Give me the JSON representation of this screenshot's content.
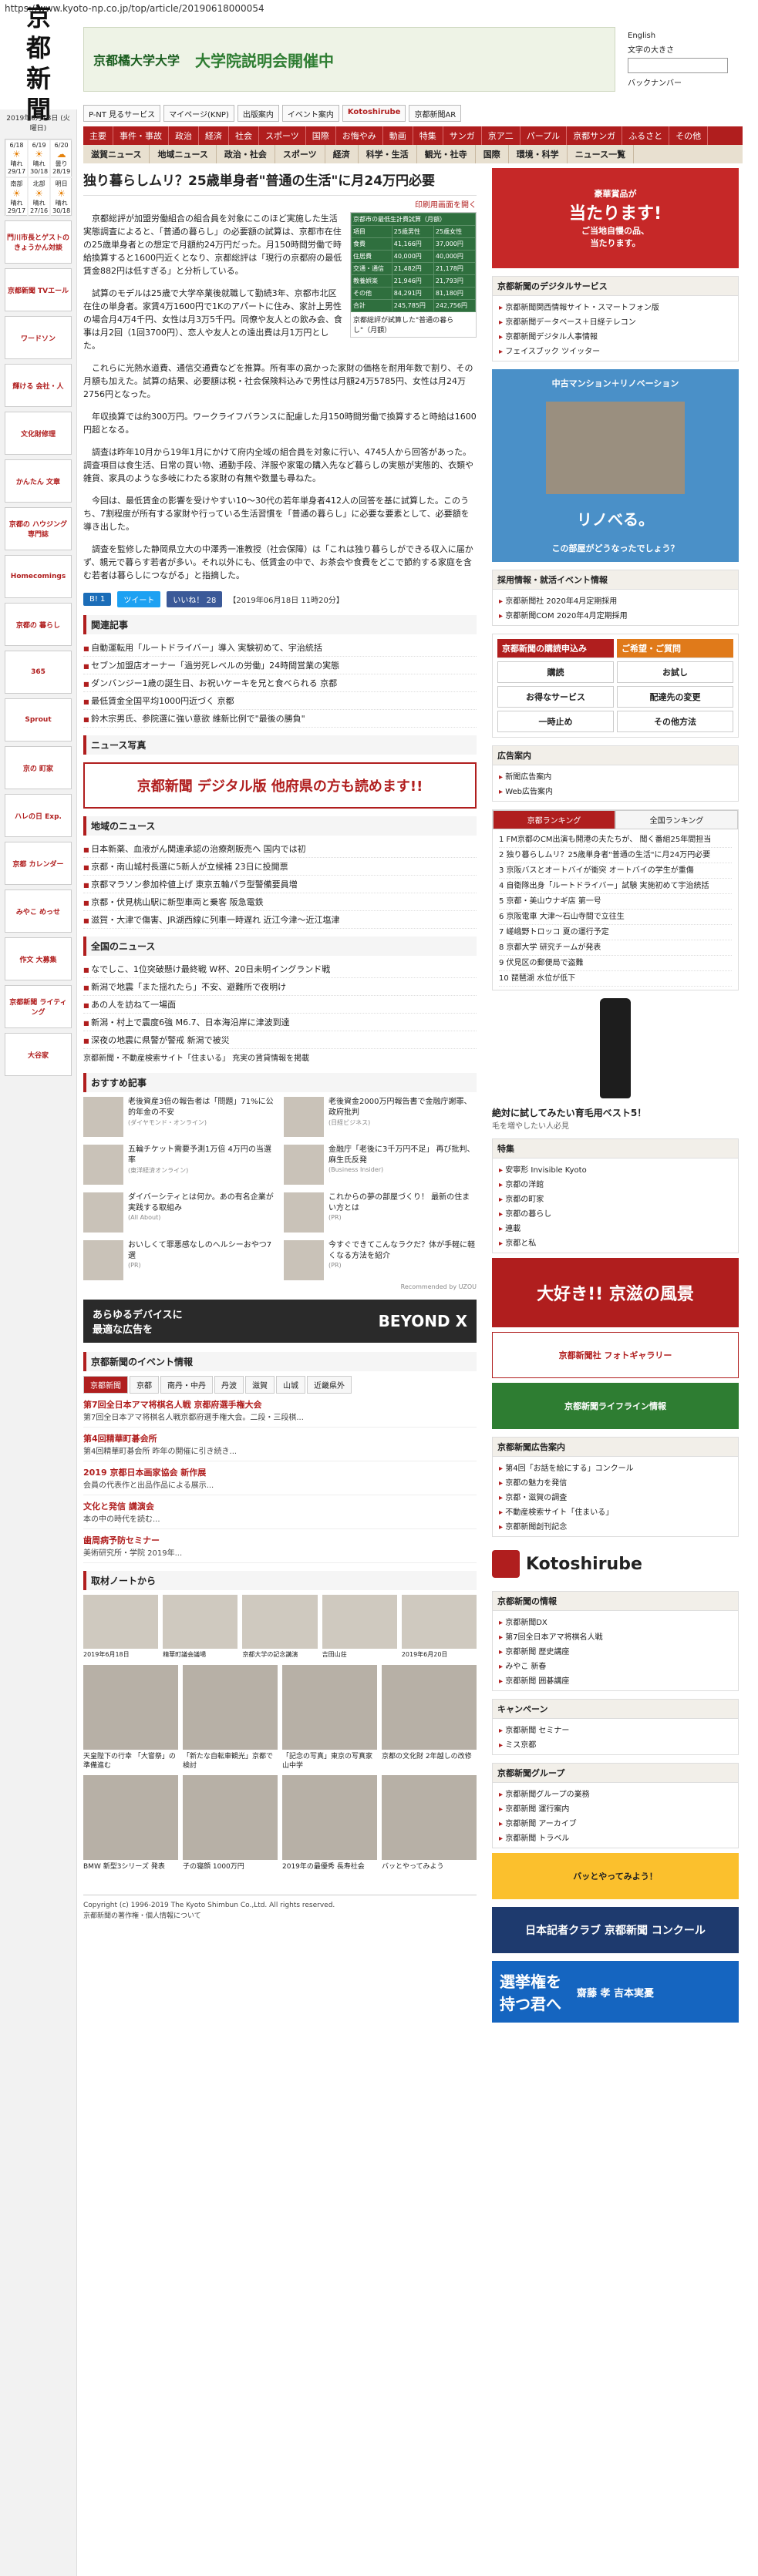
{
  "url": "https://www.kyoto-np.co.jp/top/article/20190618000054",
  "logo": [
    "京",
    "都",
    "新",
    "聞"
  ],
  "rail": {
    "date": "2019年6月18日 (火曜日)",
    "weather": [
      {
        "day": "6/18",
        "label": "晴れ",
        "temp": "29/17"
      },
      {
        "day": "6/19",
        "label": "晴れ",
        "temp": "30/18"
      },
      {
        "day": "6/20",
        "label": "曇り",
        "temp": "28/19"
      },
      {
        "day": "南部",
        "label": "晴れ",
        "temp": "29/17"
      },
      {
        "day": "北部",
        "label": "晴れ",
        "temp": "27/16"
      },
      {
        "day": "明日",
        "label": "晴れ",
        "temp": "30/18"
      }
    ],
    "ads": [
      "門川市長とゲストの きょうかん対談",
      "京都新聞 TVエール",
      "ワードソン",
      "輝ける 会社・人",
      "文化財修理",
      "かんたん 文章",
      "京都の ハウジング 専門誌",
      "Homecomings",
      "京都の 暮らし",
      "365",
      "Sprout",
      "京の 町家",
      "ハレの日 Exp.",
      "京都 カレンダー",
      "みやこ めっせ",
      "作文 大募集",
      "京都新聞 ライティング",
      "大谷家"
    ]
  },
  "header": {
    "ad_university": "京都橘大学大学",
    "ad_tagline": "大学院説明会開催中",
    "english": "English",
    "font_size": "文字の大きさ",
    "search_placeholder": "",
    "backnumber": "バックナンバー",
    "services": [
      "P-NT 見るサービス",
      "マイページ(KNP)",
      "出版案内",
      "イベント案内",
      "Kotoshirube",
      "京都新聞AR"
    ]
  },
  "nav": {
    "primary": [
      "主要",
      "事件・事故",
      "政治",
      "経済",
      "社会",
      "スポーツ",
      "国際",
      "お悔やみ",
      "動画",
      "特集",
      "サンガ",
      "京ア二",
      "パープル",
      "京都サンガ",
      "ふるさと",
      "その他"
    ],
    "secondary": [
      "滋賀ニュース",
      "地域ニュース",
      "政治・社会",
      "スポーツ",
      "経済",
      "科学・生活",
      "観光・社寺",
      "国際",
      "環境・科学",
      "ニュース一覧"
    ]
  },
  "article": {
    "title": "独り暮らしムリ？25歳単身者\"普通の生活\"に月24万円必要",
    "print": "印刷用画面を開く",
    "figure": {
      "header": "京都市の最低生計費試算（月額）",
      "rows": [
        [
          "項目",
          "25歳男性",
          "25歳女性"
        ],
        [
          "食費",
          "41,166円",
          "37,000円"
        ],
        [
          "住居費",
          "40,000円",
          "40,000円"
        ],
        [
          "交通・通信",
          "21,482円",
          "21,178円"
        ],
        [
          "教養娯楽",
          "21,946円",
          "21,793円"
        ],
        [
          "その他",
          "84,291円",
          "81,180円"
        ],
        [
          "合計",
          "245,785円",
          "242,756円"
        ]
      ],
      "caption": "京都総評が試算した\"普通の暮らし\"（月額）"
    },
    "paragraphs": [
      "京都総評が加盟労働組合の組合員を対象にこのほど実施した生活実態調査によると、「普通の暮らし」の必要額の試算は、京都市在住の25歳単身者との想定で月額約24万円だった。月150時間労働で時給換算すると1600円近くとなり、京都総評は「現行の京都府の最低賃金882円は低すぎる」と分析している。",
      "試算のモデルは25歳で大学卒業後就職して勤続3年、京都市北区在住の単身者。家賃4万1600円で1Kのアパートに住み、家計上男性の場合月4万4千円、女性は月3万5千円。同僚や友人との飲み会、食事は月2回（1回3700円）、恋人や友人との遠出費は月1万円とした。",
      "これらに光熱水道費、通信交通費などを推算。所有率の高かった家財の価格を耐用年数で割り、その月額も加えた。試算の結果、必要額は税・社会保険料込みで男性は月額24万5785円、女性は月24万2756円となった。",
      "年収換算では約300万円。ワークライフバランスに配慮した月150時間労働で換算すると時給は1600円超となる。",
      "調査は昨年10月から19年1月にかけて府内全域の組合員を対象に行い、4745人から回答があった。調査項目は食生活、日常の買い物、通勤手段、洋服や家電の購入先など暮らしの実態が実態的、衣類や雑貨、家具のような多岐にわたる家財の有無や数量も尋ねた。",
      "今回は、最低賃金の影響を受けやすい10〜30代の若年単身者412人の回答を基に試算した。このうち、7割程度が所有する家財や行っている生活習慣を「普通の暮らし」に必要な要素として、必要額を導き出した。",
      "調査を監修した静岡県立大の中澤秀一准教授（社会保障）は「これは独り暮らしができる収入に届かず、親元で暮らす若者が多い。それ以外にも、低賃金の中で、お茶会や食費をどこで節約する家庭を含む若者は暮らしにつながる」と指摘した。"
    ],
    "share": {
      "b": "B! 1",
      "tw": "ツイート",
      "fb": "いいね！ 28"
    },
    "timestamp": "【2019年06月18日 11時20分】"
  },
  "related": {
    "heading": "関連記事",
    "items": [
      "自動運転用「ルートドライバー」導入 実験初めて、宇治統括",
      "セブン加盟店オーナー「過労死レベルの労働」24時間営業の実態",
      "ダンバンジー1歳の誕生日、お祝いケーキを兄と食べられる 京都",
      "最低賃金全国平均1000円近づく 京都",
      "鈴木宗男氏、参院選に強い意欲 維新比例で\"最後の勝負\""
    ],
    "photo_label": "ニュース写真"
  },
  "digital_banner": "京都新聞 デジタル版 他府県の方も読めます!!",
  "local_news": {
    "heading": "地域のニュース",
    "items": [
      "日本新薬、血液がん関連承認の治療剤販売へ 国内では初",
      "京都・南山城村長選に5新人が立候補 23日に投開票",
      "京都マラソン参加枠値上げ 東京五輪パラ型警備要員増",
      "京都・伏見桃山駅に新型車両と乗客 阪急電鉄",
      "滋賀・大津で傷害、JR湖西線に列車一時遅れ 近江今津〜近江塩津"
    ]
  },
  "national_news": {
    "heading": "全国のニュース",
    "items": [
      "なでしこ、1位突破懸け最終戦 W杯、20日未明イングランド戦",
      "新潟で地震「また揺れたら」不安、避難所で夜明け",
      "あの人を訪ねて一場面",
      "新潟・村上で震度6強 M6.7、日本海沿岸に津波到達",
      "深夜の地震に県警が警戒 新潟で被災"
    ],
    "ad_line": "京都新聞・不動産検索サイト「住まいる」 充実の賃貸情報を掲載"
  },
  "recommended": {
    "heading": "おすすめ記事",
    "items": [
      {
        "title": "老後資産3倍の報告者は「問題」71%に公的年金の不安",
        "src": "(ダイヤモンド・オンライン)"
      },
      {
        "title": "老後資金2000万円報告書で金融庁謝罪、政府批判",
        "src": "(日経ビジネス)"
      },
      {
        "title": "五輪チケット需要予測1万倍 4万円の当選率",
        "src": "(東洋経済オンライン)"
      },
      {
        "title": "金融庁「老後に3千万円不足」 再び批判、麻生氏反発",
        "src": "(Business Insider)"
      },
      {
        "title": "ダイバーシティとは何か。あの有名企業が実践する取組み",
        "src": "(All About)"
      },
      {
        "title": "これからの夢の部屋づくり！ 最新の住まい方とは",
        "src": "(PR)"
      },
      {
        "title": "おいしくて罪悪感なしのヘルシーおやつ7選",
        "src": "(PR)"
      },
      {
        "title": "今すぐできてこんなラクだ？体が手軽に軽くなる方法を紹介",
        "src": "(PR)"
      }
    ],
    "powered": "Recommended by UZOU"
  },
  "beyond_ad": {
    "line1": "あらゆるデバイスに",
    "line2": "最適な広告を",
    "brand": "BEYOND X"
  },
  "events": {
    "heading": "京都新聞のイベント情報",
    "tabs": [
      "京都新聞",
      "京都",
      "南丹・中丹",
      "丹波",
      "滋賀",
      "山城",
      "近畿県外"
    ],
    "items": [
      {
        "h": "第7回全日本アマ将棋名人戦 京都府選手権大会",
        "d": "第7回全日本アマ将棋名人戦京都府選手権大会。二段・三段棋..."
      },
      {
        "h": "第4回精華町碁会所",
        "d": "第4回精華町碁会所 昨年の開催に引き続き..."
      },
      {
        "h": "2019 京都日本画家協会 新作展",
        "d": "会員の代表作と出品作品による展示..."
      },
      {
        "h": "文化と発信 講演会",
        "d": "本の中の時代を読む..."
      },
      {
        "h": "歯周病予防セミナー",
        "d": "美術研究所・学院 2019年..."
      }
    ]
  },
  "photo_notes": {
    "heading": "取材ノートから",
    "captions": [
      "2019年6月18日",
      "精華町議会議場",
      "京都大学の記念講演",
      "吉田山荘",
      "2019年6月20日"
    ]
  },
  "bottom_cards": [
    "天皇陛下の行幸 「大嘗祭」の準備進む",
    "「新たな自転車観光」京都で検討",
    "「記念の写真」東京の写真家 山中学",
    "京都の文化財 2年越しの改修",
    "BMW 新型3シリーズ 発表",
    "子の寝顔 1000万円",
    "2019年の最優秀 長寿社会",
    "バッとやってみよう"
  ],
  "footer": {
    "copyright": "Copyright (c) 1996-2019 The Kyoto Shimbun Co.,Ltd. All rights reserved.",
    "note": "京都新聞の著作権・個人情報について"
  },
  "side": {
    "top_ad": {
      "line1": "豪華賞品が",
      "line2": "当たります!",
      "line3": "ご当地自慢の品、",
      "line4": "当たります。"
    },
    "digital_services": {
      "heading": "京都新聞のデジタルサービス",
      "items": [
        "京都新聞関西情報サイト・スマートフォン版",
        "京都新聞データベース＋日経テレコン",
        "京都新聞デジタル人事情報",
        "フェイスブック ツイッター"
      ]
    },
    "room_ad": {
      "title": "中古マンション＋リノベーション",
      "sub": "リノべる。",
      "foot": "この部屋がどうなったでしょう？"
    },
    "recruit": {
      "heading": "採用情報・就活イベント情報",
      "items": [
        "京都新聞社 2020年4月定期採用",
        "京都新聞COM 2020年4月定期採用"
      ]
    },
    "purchase": {
      "left": "京都新聞の購読申込み",
      "right": "ご希望・ご質問",
      "buttons": [
        "購読",
        "お試し",
        "お得なサービス",
        "配達先の変更",
        "一時止め",
        "その他方法"
      ]
    },
    "ads_info": {
      "heading": "広告案内",
      "items": [
        "新聞広告案内",
        "Web広告案内"
      ]
    },
    "ranking": {
      "tabs": [
        "京都ランキング",
        "全国ランキング"
      ],
      "items": [
        "1 FM京都のCM出演も開港の夫たちが、 聞く番組25年間担当",
        "2 独り暮らしムリ？25歳単身者\"普通の生活\"に月24万円必要",
        "3 京阪バスとオートバイが衝突 オートバイの学生が重傷",
        "4 自衛隊出身「ルートドライバー」試験 実施初めて宇治統括",
        "5 京都・美山ウナギ店 第一号",
        "6 京阪電車 大津〜石山寺間で立往生",
        "7 嵯峨野トロッコ 夏の運行予定",
        "8 京都大学 研究チームが発表",
        "9 伏見区の郵便局で盗難",
        "10 琵琶湖 水位が低下"
      ]
    },
    "bottle_ad": {
      "title": "絶対に試してみたい育毛用ベスト5！",
      "sub": "毛を増やしたい人必見"
    },
    "special": {
      "heading": "特集",
      "items": [
        "安寧形 Invisible Kyoto",
        "京都の洋館",
        "京都の町家",
        "京都の暮らし",
        "連載",
        "京都と私"
      ]
    },
    "scenic_ad": "大好き!! 京滋の風景",
    "photo_service": "京都新聞社 フォトギャラリー",
    "life_info": "京都新聞ライフライン情報",
    "adguide": {
      "heading": "京都新聞広告案内",
      "items": [
        "第4回「お話を絵にする」コンクール",
        "京都の魅力を発信",
        "京都・滋賀の調査",
        "不動産検索サイト「住まいる」",
        "京都新聞創刊記念"
      ]
    },
    "kotoshirube": "Kotoshirube",
    "newsinfo": {
      "heading": "京都新聞の情報",
      "items": [
        "京都新聞DX",
        "第7回全日本アマ将棋名人戦",
        "京都新聞 歴史講座",
        "みやこ 新春",
        "京都新聞 囲碁講座"
      ]
    },
    "campaign": {
      "heading": "キャンペーン",
      "items": [
        "京都新聞 セミナー",
        "ミス京都"
      ]
    },
    "group": {
      "heading": "京都新聞グループ",
      "items": [
        "京都新聞グループの業務",
        "京都新聞 運行案内",
        "京都新聞 アーカイブ",
        "京都新聞 トラベル"
      ]
    },
    "pink_ad": "バッとやってみよう！",
    "nikkei_ad": "日本記者クラブ 京都新聞 コンクール",
    "vote_ad": {
      "line1": "選挙権を",
      "line2": "持つ君へ",
      "name": "齋藤 孝 吉本実憂"
    }
  }
}
